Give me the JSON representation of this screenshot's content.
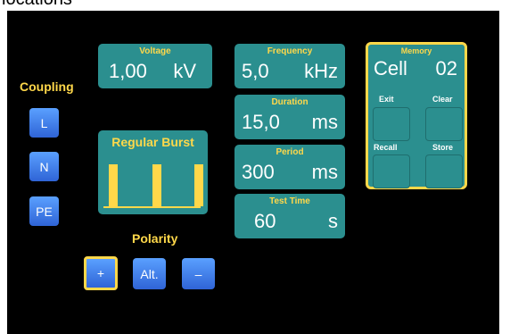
{
  "caption": "locations",
  "coupling": {
    "title": "Coupling",
    "buttons": [
      "L",
      "N",
      "PE"
    ]
  },
  "voltage": {
    "label": "Voltage",
    "value": "1,00",
    "unit": "kV"
  },
  "frequency": {
    "label": "Frequency",
    "value": "5,0",
    "unit": "kHz"
  },
  "duration": {
    "label": "Duration",
    "value": "15,0",
    "unit": "ms"
  },
  "period": {
    "label": "Period",
    "value": "300",
    "unit": "ms"
  },
  "test_time": {
    "label": "Test Time",
    "value": "60",
    "unit": "s"
  },
  "burst": {
    "title": "Regular Burst"
  },
  "polarity": {
    "title": "Polarity",
    "buttons": [
      "+",
      "Alt.",
      "–"
    ]
  },
  "memory": {
    "title": "Memory",
    "cell_label": "Cell",
    "cell_value": "02",
    "exit": "Exit",
    "clear": "Clear",
    "recall": "Recall",
    "store": "Store"
  },
  "colors": {
    "accent": "#ffd84a",
    "panel": "#2b8f8f",
    "button": "#3f7ef0",
    "screen": "#000000"
  }
}
